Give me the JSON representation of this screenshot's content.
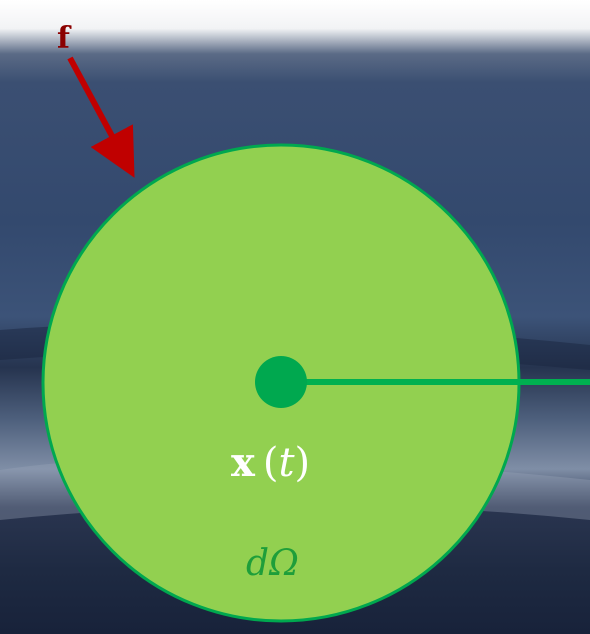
{
  "labels": {
    "force": "f",
    "position_vec": "x",
    "position_open": "(",
    "position_var": "t",
    "position_close": ")",
    "domain": "dΩ"
  },
  "colors": {
    "disk_fill": "#92d050",
    "disk_stroke": "#00a84f",
    "center_point": "#00a84f",
    "radius_line": "#00b050",
    "force_arrow": "#c00000",
    "force_label": "#8b0000",
    "position_label": "#ffffff",
    "domain_label": "#1e9e3a",
    "background_top": "#ffffff",
    "background_mid": "#30456a",
    "background_dark": "#1a263f"
  },
  "icons": {
    "force_arrow": "arrow-icon",
    "center_point": "dot-icon"
  }
}
